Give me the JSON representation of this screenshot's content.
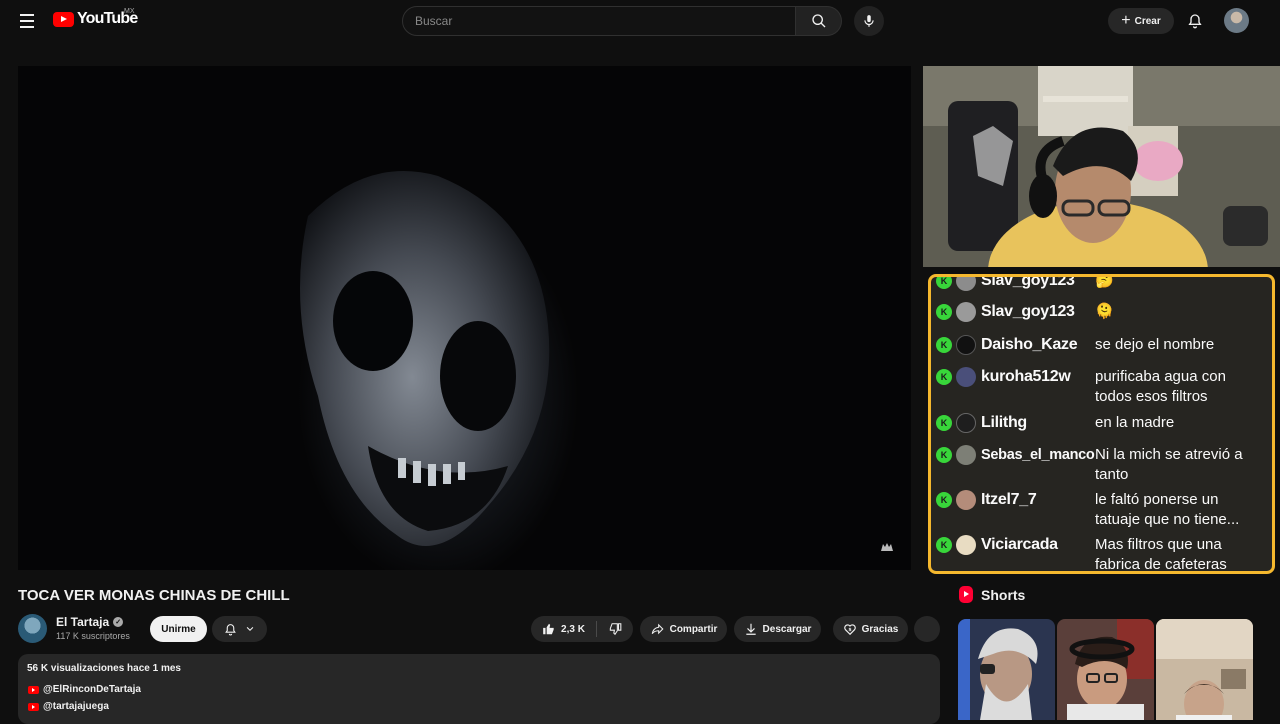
{
  "header": {
    "logo_text": "YouTube",
    "country_code": "MX",
    "search_placeholder": "Buscar",
    "create_label": "Crear",
    "icons": [
      "menu-icon",
      "youtube-logo-icon",
      "search-icon",
      "mic-icon",
      "plus-icon",
      "bell-icon",
      "avatar"
    ]
  },
  "chat": {
    "border_color": "#f5b82e",
    "badge_letter": "K",
    "badge_color": "#38d63a",
    "messages": [
      {
        "user": "Slav_goy123",
        "text": "🤔"
      },
      {
        "user": "Slav_goy123",
        "text": "🫠"
      },
      {
        "user": "Daisho_Kaze",
        "text": "se dejo el nombre"
      },
      {
        "user": "kuroha512w",
        "text": "purificaba agua con todos esos filtros"
      },
      {
        "user": "Lilithg",
        "text": "en la madre"
      },
      {
        "user": "Sebas_el_manco",
        "text": "Ni la mich se atrevió a tanto"
      },
      {
        "user": "Itzel7_7",
        "text": "le faltó ponerse un tatuaje que no tiene..."
      },
      {
        "user": "Viciarcada",
        "text": "Mas filtros que una fabrica de cafeteras"
      }
    ]
  },
  "video": {
    "title": "TOCA VER MONAS CHINAS DE CHILL",
    "channel_name": "El Tartaja",
    "subscribers": "117 K suscriptores",
    "join_label": "Unirme",
    "like_count": "2,3 K",
    "share_label": "Compartir",
    "download_label": "Descargar",
    "thanks_label": "Gracias"
  },
  "description": {
    "stats": "56 K visualizaciones  hace 1 mes",
    "links": [
      "@ElRinconDeTartaja",
      "@tartajajuega"
    ]
  },
  "shorts": {
    "title": "Shorts",
    "accent_color": "#ff0033"
  }
}
